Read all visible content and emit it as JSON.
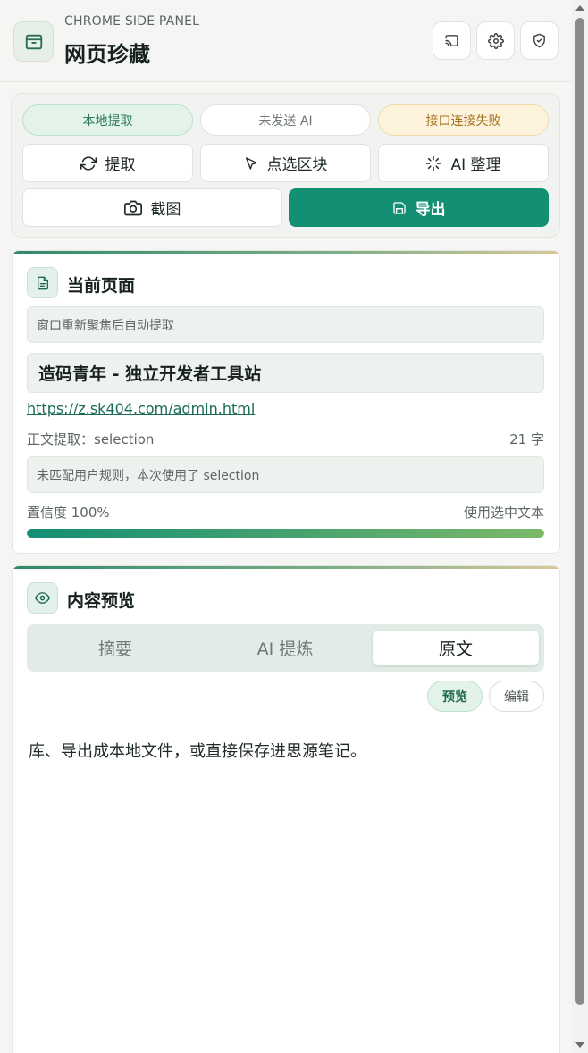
{
  "header": {
    "eyebrow": "CHROME SIDE PANEL",
    "title": "网页珍藏",
    "icons": [
      "archive-icon",
      "cast-icon",
      "gear-icon",
      "shield-check-icon"
    ]
  },
  "status": {
    "local": "本地提取",
    "ai": "未发送 AI",
    "api": "接口连接失败"
  },
  "actions": {
    "extract": "提取",
    "pick_block": "点选区块",
    "ai_organize": "AI 整理",
    "screenshot": "截图",
    "export": "导出"
  },
  "current_page": {
    "section_title": "当前页面",
    "auto_hint": "窗口重新聚焦后自动提取",
    "page_title": "造码青年 - 独立开发者工具站",
    "url": "https://z.sk404.com/admin.html",
    "extract_method": "正文提取：selection",
    "char_count": "21 字",
    "rule_note": "未匹配用户规则，本次使用了 selection",
    "confidence": "置信度 100%",
    "source": "使用选中文本",
    "confidence_value": 1.0
  },
  "preview": {
    "section_title": "内容预览",
    "tabs": [
      "摘要",
      "AI 提炼",
      "原文"
    ],
    "active_tab": "原文",
    "mode_preview": "预览",
    "mode_edit": "编辑",
    "content": "库、导出成本地文件，或直接保存进思源笔记。"
  },
  "colors": {
    "accent": "#138f74",
    "ok": "#2f7a57",
    "warn": "#a5701b"
  }
}
